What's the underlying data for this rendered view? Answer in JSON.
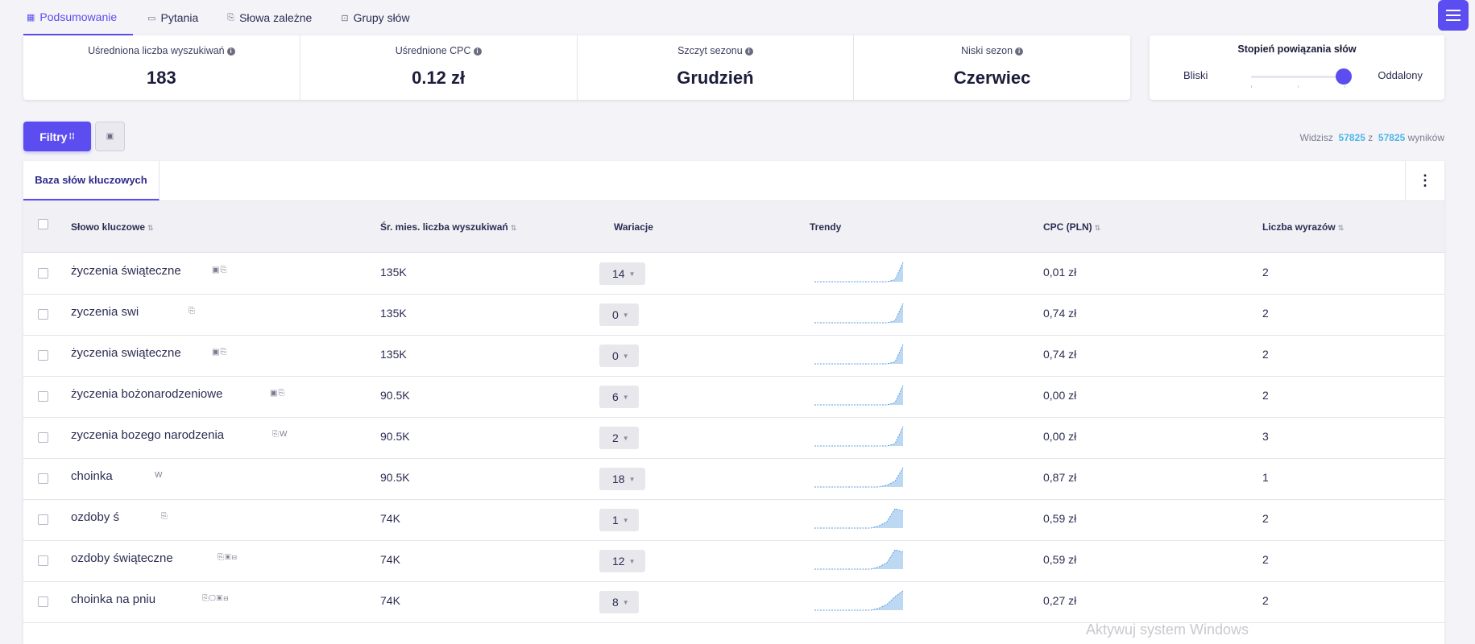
{
  "tabs": [
    {
      "label": "Podsumowanie",
      "icon": "grid-icon",
      "active": true
    },
    {
      "label": "Pytania",
      "icon": "chat-icon"
    },
    {
      "label": "Słowa zależne",
      "icon": "document-icon"
    },
    {
      "label": "Grupy słów",
      "icon": "group-icon"
    }
  ],
  "stats": [
    {
      "label": "Uśredniona liczba wyszukiwań",
      "value": "183"
    },
    {
      "label": "Uśrednione CPC",
      "value": "0.12 zł"
    },
    {
      "label": "Szczyt sezonu",
      "value": "Grudzień"
    },
    {
      "label": "Niski sezon",
      "value": "Czerwiec"
    }
  ],
  "relation": {
    "title": "Stopień powiązania słów",
    "near": "Bliski",
    "far": "Oddalony",
    "level": 1.0
  },
  "toolbar": {
    "filter_label": "Filtry",
    "save_icon": "save-icon"
  },
  "results": {
    "prefix": "Widzisz",
    "shown": "57825",
    "mid": "z",
    "total": "57825",
    "suffix": "wyników"
  },
  "panel": {
    "tab_label": "Baza słów kluczowych"
  },
  "columns": {
    "keyword": "Słowo kluczowe",
    "volume": "Śr. mies. liczba wyszukiwań",
    "variations": "Wariacje",
    "trends": "Trendy",
    "cpc": "CPC (PLN)",
    "words": "Liczba wyrazów"
  },
  "colors": {
    "accent": "#5b4df0",
    "highlight": "#4fb5e8",
    "trend_fill": "#bcd8f3",
    "trend_line": "#5a9de0"
  },
  "rows": [
    {
      "keyword": "życzenia świąteczne",
      "icons": "▣⎘",
      "volume": "135K",
      "variations": "14",
      "cpc": "0,01 zł",
      "words": "2",
      "trend": [
        0,
        0,
        0,
        0,
        0,
        0,
        0,
        0,
        0,
        0,
        1,
        10
      ]
    },
    {
      "keyword": "zyczenia swi",
      "icons": "⎘",
      "volume": "135K",
      "variations": "0",
      "cpc": "0,74 zł",
      "words": "2",
      "trend": [
        0,
        0,
        0,
        0,
        0,
        0,
        0,
        0,
        0,
        0,
        1,
        10
      ]
    },
    {
      "keyword": "życzenia swiąteczne",
      "icons": "▣⎘",
      "volume": "135K",
      "variations": "0",
      "cpc": "0,74 zł",
      "words": "2",
      "trend": [
        0,
        0,
        0,
        0,
        0,
        0,
        0,
        0,
        0,
        0,
        1,
        10
      ]
    },
    {
      "keyword": "życzenia bożonarodzeniowe",
      "icons": "▣⎘",
      "volume": "90.5K",
      "variations": "6",
      "cpc": "0,00 zł",
      "words": "2",
      "trend": [
        0,
        0,
        0,
        0,
        0,
        0,
        0,
        0,
        0,
        0,
        1,
        9
      ]
    },
    {
      "keyword": "zyczenia bozego narodzenia",
      "icons": "⎘W",
      "volume": "90.5K",
      "variations": "2",
      "cpc": "0,00 zł",
      "words": "3",
      "trend": [
        0,
        0,
        0,
        0,
        0,
        0,
        0,
        0,
        0,
        0,
        1,
        9
      ]
    },
    {
      "keyword": "choinka",
      "icons": "W",
      "volume": "90.5K",
      "variations": "18",
      "cpc": "0,87 zł",
      "words": "1",
      "trend": [
        0,
        0,
        0,
        0,
        0,
        0,
        0,
        0,
        0,
        1,
        3,
        10
      ]
    },
    {
      "keyword": "ozdoby ś",
      "icons": "⎘",
      "volume": "74K",
      "variations": "1",
      "cpc": "0,59 zł",
      "words": "2",
      "trend": [
        0,
        0,
        0,
        0,
        0,
        0,
        0,
        0,
        1,
        3,
        9,
        8
      ]
    },
    {
      "keyword": "ozdoby świąteczne",
      "icons": "⎘▣⊟",
      "volume": "74K",
      "variations": "12",
      "cpc": "0,59 zł",
      "words": "2",
      "trend": [
        0,
        0,
        0,
        0,
        0,
        0,
        0,
        0,
        1,
        3,
        9,
        8
      ]
    },
    {
      "keyword": "choinka na pniu",
      "icons": "⎘▢▣⊟",
      "volume": "74K",
      "variations": "8",
      "cpc": "0,27 zł",
      "words": "2",
      "trend": [
        0,
        0,
        0,
        0,
        0,
        0,
        0,
        0,
        1,
        3,
        7,
        10
      ]
    }
  ],
  "watermark": "Aktywuj system Windows"
}
